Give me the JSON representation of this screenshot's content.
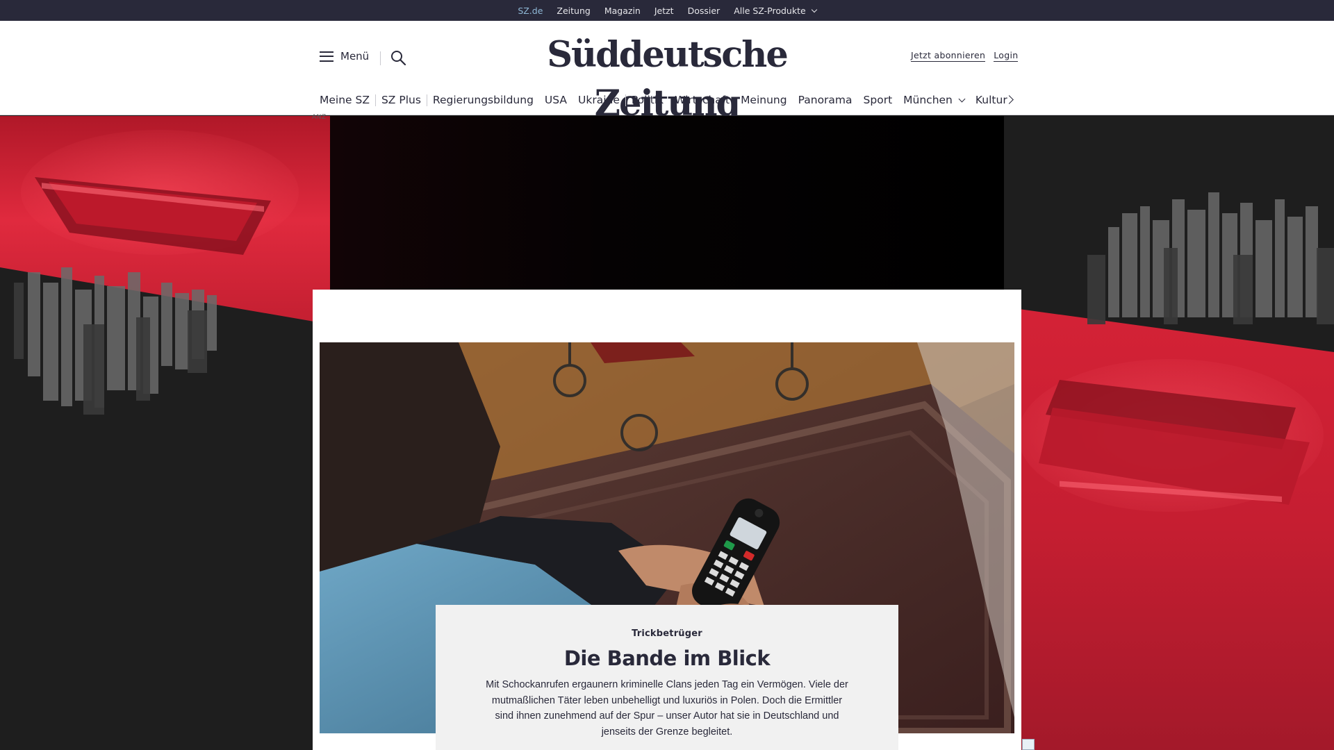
{
  "topbar": {
    "items": [
      {
        "label": "SZ.de",
        "active": true
      },
      {
        "label": "Zeitung"
      },
      {
        "label": "Magazin"
      },
      {
        "label": "Jetzt"
      },
      {
        "label": "Dossier"
      },
      {
        "label": "Alle SZ-Produkte",
        "has_dropdown": true
      }
    ]
  },
  "header": {
    "menu_label": "Menü",
    "logo": "Süddeutsche Zeitung",
    "subscribe_label": "Jetzt abonnieren",
    "login_label": "Login"
  },
  "nav": {
    "items": [
      "Meine SZ",
      "SZ Plus",
      "Regierungsbildung",
      "USA",
      "Ukraine",
      "Politik",
      "Wirtschaft",
      "Meinung",
      "Panorama",
      "Sport",
      "München",
      "Kultur"
    ]
  },
  "ad": {
    "label": "ANZ"
  },
  "teaser": {
    "kicker": "Trickbetrüger",
    "headline": "Die Bande im Blick",
    "summary": "Mit Schockanrufen ergaunern kriminelle Clans jeden Tag ein Vermögen. Viele der mutmaßlichen Täter leben unbehelligt und luxuriös in Polen.  Doch die Ermittler sind ihnen zunehmend auf der Spur – unser Autor hat sie in Deutschland und jenseits der Grenze begleitet."
  },
  "colors": {
    "topbar_bg": "#29293a",
    "active_link": "#8fb8d6",
    "ad_red": "#d42236",
    "text": "#29293a"
  }
}
